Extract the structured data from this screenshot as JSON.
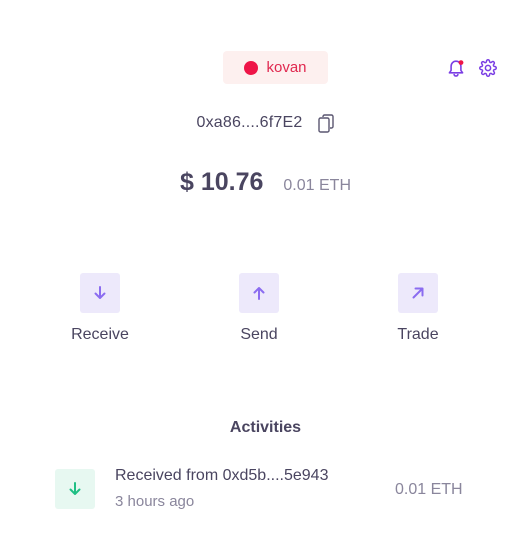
{
  "network": {
    "name": "kovan",
    "dot_color": "#ee1548"
  },
  "header_icons": {
    "notifications": "bell-icon",
    "settings": "gear-icon",
    "accent_color": "#7b3fe4"
  },
  "account": {
    "address": "0xa86....6f7E2",
    "copy_icon": "copy-icon"
  },
  "balance": {
    "usd": "$ 10.76",
    "eth": "0.01 ETH"
  },
  "actions": [
    {
      "label": "Receive",
      "icon": "arrow-down-icon"
    },
    {
      "label": "Send",
      "icon": "arrow-up-icon"
    },
    {
      "label": "Trade",
      "icon": "arrow-up-right-icon"
    }
  ],
  "activities": {
    "title": "Activities",
    "items": [
      {
        "icon": "arrow-down-icon",
        "title": "Received from 0xd5b....5e943",
        "time": "3 hours ago",
        "amount": "0.01 ETH",
        "status_color": "#1fbf84"
      }
    ]
  }
}
